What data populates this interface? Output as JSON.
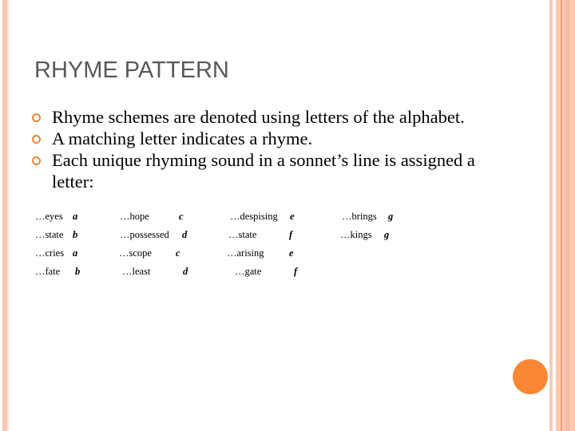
{
  "slide": {
    "title": "RHYME PATTERN",
    "bullets": [
      "Rhyme schemes are denoted using letters of the alphabet.",
      "A matching letter indicates a rhyme.",
      "Each unique rhyming sound in a sonnet’s line is assigned a letter:"
    ],
    "rhyme_columns": [
      [
        {
          "word": "…eyes",
          "letter": "a"
        },
        {
          "word": "…state",
          "letter": "b"
        },
        {
          "word": "…cries",
          "letter": "a"
        },
        {
          "word": "…fate",
          "letter": "b"
        }
      ],
      [
        {
          "word": "…hope",
          "letter": "c"
        },
        {
          "word": "…possessed",
          "letter": "d"
        },
        {
          "word": "…scope",
          "letter": "c"
        },
        {
          "word": "…least",
          "letter": "d"
        }
      ],
      [
        {
          "word": "…despising",
          "letter": "e"
        },
        {
          "word": "…state",
          "letter": "f"
        },
        {
          "word": "…arising",
          "letter": "e"
        },
        {
          "word": "…gate",
          "letter": "f"
        }
      ],
      [
        {
          "word": "…brings",
          "letter": "g"
        },
        {
          "word": "…kings",
          "letter": "g"
        }
      ]
    ]
  },
  "theme": {
    "accent": "#fb8633",
    "border": "#fcc8b4",
    "title_color": "#56595c"
  }
}
